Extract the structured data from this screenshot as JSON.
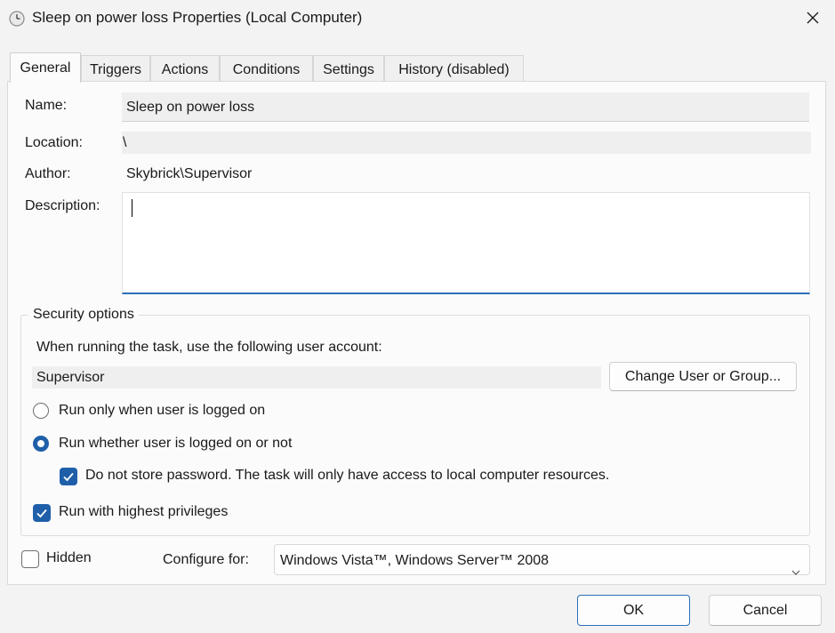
{
  "window": {
    "title": "Sleep on power loss Properties (Local Computer)"
  },
  "tabs": [
    {
      "label": "General",
      "active": true
    },
    {
      "label": "Triggers",
      "active": false
    },
    {
      "label": "Actions",
      "active": false
    },
    {
      "label": "Conditions",
      "active": false
    },
    {
      "label": "Settings",
      "active": false
    },
    {
      "label": "History (disabled)",
      "active": false
    }
  ],
  "general": {
    "name_label": "Name:",
    "name_value": "Sleep on power loss",
    "location_label": "Location:",
    "location_value": "\\",
    "author_label": "Author:",
    "author_value": "Skybrick\\Supervisor",
    "description_label": "Description:",
    "description_value": ""
  },
  "security": {
    "legend": "Security options",
    "account_prompt": "When running the task, use the following user account:",
    "user_account": "Supervisor",
    "change_button": "Change User or Group...",
    "radio_logged_on": {
      "label": "Run only when user is logged on",
      "selected": false
    },
    "radio_whether": {
      "label": "Run whether user is logged on or not",
      "selected": true
    },
    "no_store_password": {
      "label": "Do not store password.  The task will only have access to local computer resources.",
      "checked": true
    },
    "highest_privileges": {
      "label": "Run with highest privileges",
      "checked": true
    }
  },
  "footer": {
    "hidden": {
      "label": "Hidden",
      "checked": false
    },
    "configure_label": "Configure for:",
    "configure_value": "Windows Vista™, Windows Server™ 2008",
    "ok_button": "OK",
    "cancel_button": "Cancel"
  },
  "colors": {
    "accent": "#1f5fa9",
    "focus_underline": "#2c6fb7"
  },
  "icons": {
    "title": "clock-icon",
    "close": "close-icon",
    "select": "chevron-down-icon",
    "check": "checkmark-icon"
  }
}
